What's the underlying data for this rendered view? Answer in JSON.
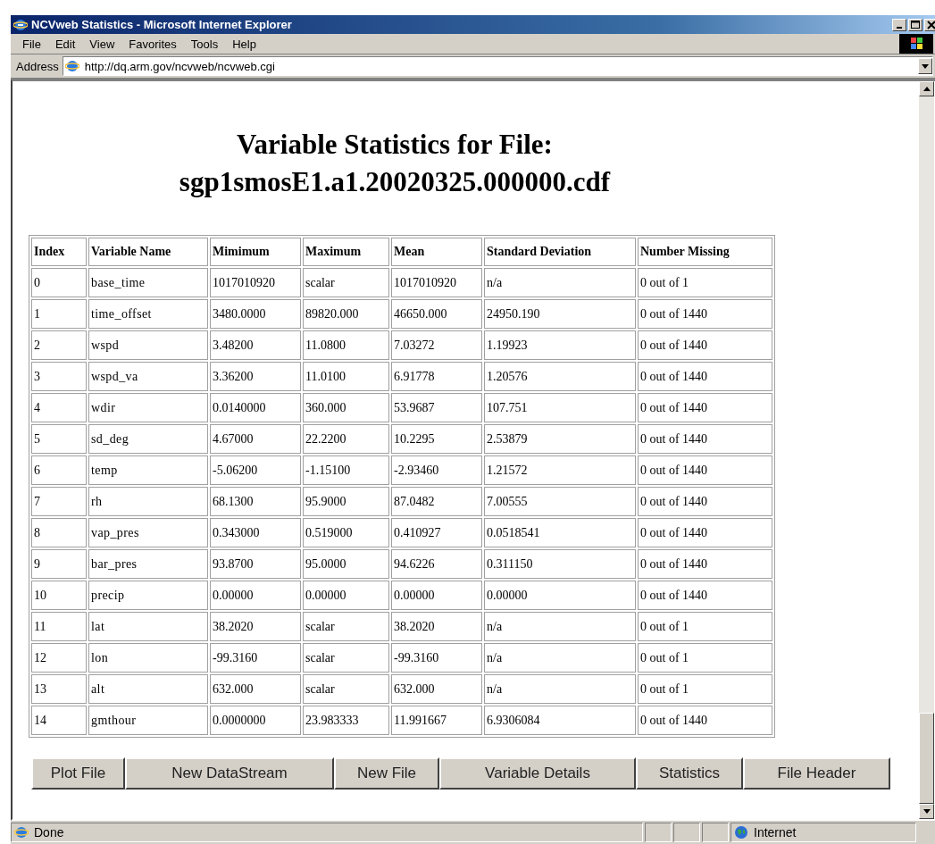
{
  "window": {
    "title": "NCVweb Statistics - Microsoft Internet Explorer"
  },
  "menu": [
    "File",
    "Edit",
    "View",
    "Favorites",
    "Tools",
    "Help"
  ],
  "address": {
    "label": "Address",
    "value": "http://dq.arm.gov/ncvweb/ncvweb.cgi"
  },
  "page": {
    "heading": [
      "Variable Statistics for File:",
      "sgp1smosE1.a1.20020325.000000.cdf"
    ],
    "table": {
      "columns": [
        "Index",
        "Variable Name",
        "Mimimum",
        "Maximum",
        "Mean",
        "Standard Deviation",
        "Number Missing"
      ],
      "rows": [
        [
          "0",
          "base_time",
          "1017010920",
          "scalar",
          "1017010920",
          "n/a",
          "0 out of 1"
        ],
        [
          "1",
          "time_offset",
          "3480.0000",
          "89820.000",
          "46650.000",
          "24950.190",
          "0 out of 1440"
        ],
        [
          "2",
          "wspd",
          "3.48200",
          "11.0800",
          "7.03272",
          "1.19923",
          "0 out of 1440"
        ],
        [
          "3",
          "wspd_va",
          "3.36200",
          "11.0100",
          "6.91778",
          "1.20576",
          "0 out of 1440"
        ],
        [
          "4",
          "wdir",
          "0.0140000",
          "360.000",
          "53.9687",
          "107.751",
          "0 out of 1440"
        ],
        [
          "5",
          "sd_deg",
          "4.67000",
          "22.2200",
          "10.2295",
          "2.53879",
          "0 out of 1440"
        ],
        [
          "6",
          "temp",
          "-5.06200",
          "-1.15100",
          "-2.93460",
          "1.21572",
          "0 out of 1440"
        ],
        [
          "7",
          "rh",
          "68.1300",
          "95.9000",
          "87.0482",
          "7.00555",
          "0 out of 1440"
        ],
        [
          "8",
          "vap_pres",
          "0.343000",
          "0.519000",
          "0.410927",
          "0.0518541",
          "0 out of 1440"
        ],
        [
          "9",
          "bar_pres",
          "93.8700",
          "95.0000",
          "94.6226",
          "0.311150",
          "0 out of 1440"
        ],
        [
          "10",
          "precip",
          "0.00000",
          "0.00000",
          "0.00000",
          "0.00000",
          "0 out of 1440"
        ],
        [
          "11",
          "lat",
          "38.2020",
          "scalar",
          "38.2020",
          "n/a",
          "0 out of 1"
        ],
        [
          "12",
          "lon",
          "-99.3160",
          "scalar",
          "-99.3160",
          "n/a",
          "0 out of 1"
        ],
        [
          "13",
          "alt",
          "632.000",
          "scalar",
          "632.000",
          "n/a",
          "0 out of 1"
        ],
        [
          "14",
          "gmthour",
          "0.0000000",
          "23.983333",
          "11.991667",
          "6.9306084",
          "0 out of 1440"
        ]
      ]
    },
    "buttons": [
      "Plot File",
      "New DataStream",
      "New File",
      "Variable Details",
      "Statistics",
      "File Header"
    ]
  },
  "status_bar": {
    "text": "Done",
    "zone": "Internet"
  }
}
